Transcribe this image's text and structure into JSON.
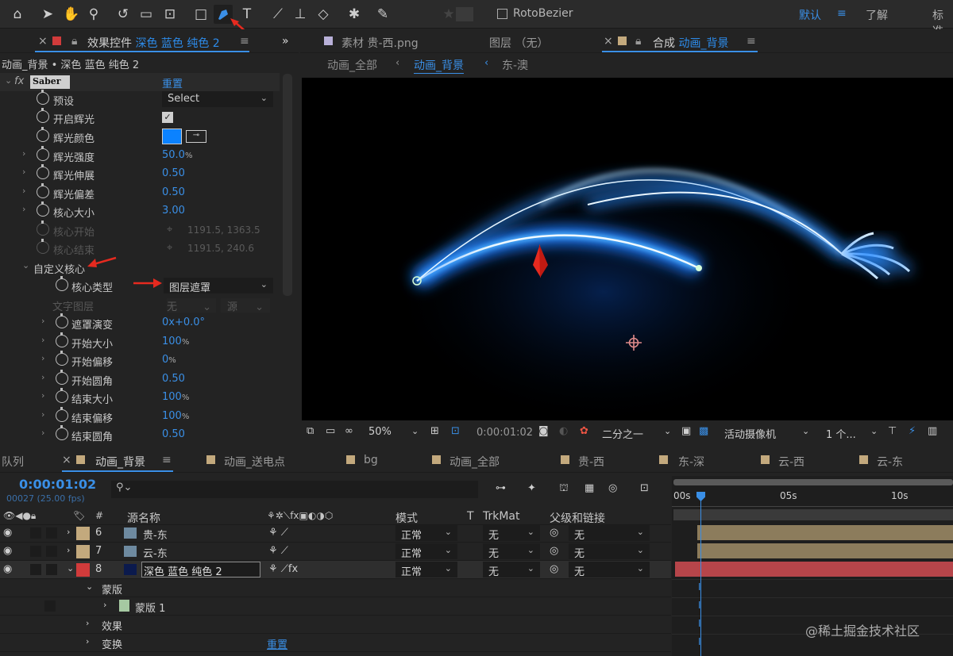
{
  "toolbar": {
    "tools": [
      "home-icon",
      "selection-arrow-icon",
      "hand-icon",
      "zoom-icon",
      "rotate-icon",
      "camera-icon",
      "pan-behind-icon",
      "rectangle-icon",
      "pen-icon",
      "type-icon",
      "brush-icon",
      "clone-stamp-icon",
      "eraser-icon",
      "roto-brush-icon",
      "puppet-pin-icon"
    ],
    "rotobezier": "RotoBezier",
    "workspace_default": "默认",
    "workspace_learn": "了解",
    "workspace_standard": "标准",
    "menu_icon": "≡"
  },
  "effects_panel": {
    "tab_label": "效果控件",
    "tab_layer": "深色 蓝色 纯色 2",
    "menu": "≡",
    "expand": "»",
    "breadcrumb": "动画_背景 • 深色 蓝色 纯色 2",
    "fx": "fx",
    "effect_name": "Saber",
    "reset": "重置",
    "props": {
      "preset": "预设",
      "preset_value": "Select",
      "glow_enable": "开启辉光",
      "glow_color": "辉光颜色",
      "glow_intensity": "辉光强度",
      "glow_intensity_value": "50.0",
      "glow_intensity_unit": "%",
      "glow_spread": "辉光伸展",
      "glow_spread_value": "0.50",
      "glow_bias": "辉光偏差",
      "glow_bias_value": "0.50",
      "core_size": "核心大小",
      "core_size_value": "3.00",
      "core_start": "核心开始",
      "core_start_value": "1191.5, 1363.5",
      "core_end": "核心结束",
      "core_end_value": "1191.5, 240.6",
      "custom_core": "自定义核心",
      "core_type": "核心类型",
      "core_type_value": "图层遮罩",
      "text_layer": "文字图层",
      "text_layer_value": "无",
      "text_layer_source": "源",
      "mask_evolution": "遮罩演变",
      "mask_evolution_value": "0x+0.0°",
      "start_size": "开始大小",
      "start_size_value": "100",
      "start_offset": "开始偏移",
      "start_offset_value": "0",
      "start_round": "开始圆角",
      "start_round_value": "0.50",
      "end_size": "结束大小",
      "end_size_value": "100",
      "end_offset": "结束偏移",
      "end_offset_value": "100",
      "end_round": "结束圆角",
      "end_round_value": "0.50",
      "pct": "%"
    }
  },
  "comp_panel": {
    "tab_footage": "素材 贵-西.png",
    "tab_layer": "图层 （无）",
    "tab_comp_prefix": "合成",
    "tab_comp_name": "动画_背景",
    "menu": "≡",
    "crumbs": [
      "动画_全部",
      "动画_背景",
      "东-澳"
    ],
    "zoom": "50%",
    "timecode": "0:00:01:02",
    "resolution": "二分之一",
    "camera": "活动摄像机",
    "views": "1 个..."
  },
  "timeline": {
    "tab_queue": "队列",
    "tabs": [
      {
        "name": "动画_背景",
        "active": true,
        "color": "#c3a97d"
      },
      {
        "name": "动画_送电点",
        "active": false,
        "color": "#c3a97d"
      },
      {
        "name": "bg",
        "active": false,
        "color": "#c3a97d"
      },
      {
        "name": "动画_全部",
        "active": false,
        "color": "#c3a97d"
      },
      {
        "name": "贵-西",
        "active": false,
        "color": "#c3a97d"
      },
      {
        "name": "东-深",
        "active": false,
        "color": "#c3a97d"
      },
      {
        "name": "云-西",
        "active": false,
        "color": "#c3a97d"
      },
      {
        "name": "云-东",
        "active": false,
        "color": "#c3a97d"
      }
    ],
    "timecode": "0:00:01:02",
    "frames": "00027 (25.00 fps)",
    "search_placeholder": "",
    "col_hash": "#",
    "col_source": "源名称",
    "col_mode": "模式",
    "col_t": "T",
    "col_trkmat": "TrkMat",
    "col_parent": "父级和链接",
    "ruler": [
      "00s",
      "05s",
      "10s"
    ],
    "layers": [
      {
        "num": "6",
        "name": "贵-东",
        "color": "#c3a97d",
        "mode": "正常",
        "trk": "无",
        "parent": "无"
      },
      {
        "num": "7",
        "name": "云-东",
        "color": "#c3a97d",
        "mode": "正常",
        "trk": "无",
        "parent": "无"
      },
      {
        "num": "8",
        "name": "深色 蓝色 纯色 2",
        "color": "#d13b3b",
        "mode": "正常",
        "trk": "无",
        "parent": "无"
      }
    ],
    "sub": {
      "masks": "蒙版",
      "mask1": "蒙版 1",
      "effects": "效果",
      "transform": "变换",
      "reset": "重置"
    }
  },
  "watermark": "@稀土掘金技术社区"
}
